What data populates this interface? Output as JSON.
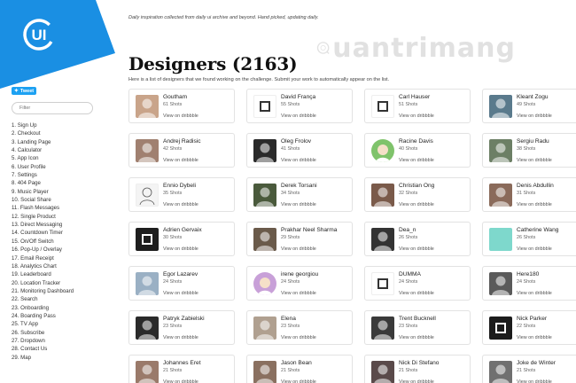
{
  "tagline": "Daily inspiration collected from daily ui archive and beyond. Hand picked, updating daily.",
  "title": "Designers (2163)",
  "subtitle": "Here is a list of designers that we found working on the challenge. Submit your work to automatically appear on the list.",
  "brand": {
    "logo_text": "UI",
    "accent": "#1a8fe3",
    "tweet": "Tweet"
  },
  "watermark": {
    "text": "uantrimang"
  },
  "filter_placeholder": "Filter",
  "nav": [
    "1. Sign Up",
    "2. Checkout",
    "3. Landing Page",
    "4. Calculator",
    "5. App Icon",
    "6. User Profile",
    "7. Settings",
    "8. 404 Page",
    "9. Music Player",
    "10. Social Share",
    "11. Flash Messages",
    "12. Single Product",
    "13. Direct Messaging",
    "14. Countdown Timer",
    "15. On/Off Switch",
    "16. Pop-Up / Overlay",
    "17. Email Receipt",
    "18. Analytics Chart",
    "19. Leaderboard",
    "20. Location Tracker",
    "21. Monitoring Dashboard",
    "22. Search",
    "23. Onboarding",
    "24. Boarding Pass",
    "25. TV App",
    "26. Subscribe",
    "27. Dropdown",
    "28. Contact Us",
    "29. Map"
  ],
  "view_label": "View on dribbble",
  "designers": [
    {
      "name": "Goutham",
      "shots": "61 Shots",
      "avatar": "photo",
      "color": "#c9a48a"
    },
    {
      "name": "David França",
      "shots": "55 Shots",
      "avatar": "logo",
      "color": "#ffffff"
    },
    {
      "name": "Carl Hauser",
      "shots": "51 Shots",
      "avatar": "logo",
      "color": "#ffffff"
    },
    {
      "name": "Kleant Zogu",
      "shots": "49 Shots",
      "avatar": "photo",
      "color": "#5a7a8c"
    },
    {
      "name": "Andrej Radisic",
      "shots": "42 Shots",
      "avatar": "photo",
      "color": "#a08070"
    },
    {
      "name": "Oleg Frolov",
      "shots": "41 Shots",
      "avatar": "photo",
      "color": "#2a2a2a"
    },
    {
      "name": "Racine Davis",
      "shots": "40 Shots",
      "avatar": "illustration",
      "color": "#7fc36b"
    },
    {
      "name": "Sergiu Radu",
      "shots": "38 Shots",
      "avatar": "photo",
      "color": "#6c7f65"
    },
    {
      "name": "Ennio Dybeli",
      "shots": "35 Shots",
      "avatar": "sketch",
      "color": "#f4f4f4"
    },
    {
      "name": "Derek Torsani",
      "shots": "34 Shots",
      "avatar": "photo",
      "color": "#4a5a3c"
    },
    {
      "name": "Christian Ong",
      "shots": "32 Shots",
      "avatar": "photo",
      "color": "#7a5a4a"
    },
    {
      "name": "Denis Abdullin",
      "shots": "31 Shots",
      "avatar": "photo",
      "color": "#8a6a5a"
    },
    {
      "name": "Adrien Gervaix",
      "shots": "30 Shots",
      "avatar": "logo",
      "color": "#1e1e1e"
    },
    {
      "name": "Prakhar Neel Sharma",
      "shots": "29 Shots",
      "avatar": "photo",
      "color": "#6a5a4a"
    },
    {
      "name": "Dea_n",
      "shots": "26 Shots",
      "avatar": "photo",
      "color": "#333333"
    },
    {
      "name": "Catherine Wang",
      "shots": "26 Shots",
      "avatar": "solid",
      "color": "#7ed8cc"
    },
    {
      "name": "Egor Lazarev",
      "shots": "24 Shots",
      "avatar": "photo",
      "color": "#9ab0c4"
    },
    {
      "name": "irene georgiou",
      "shots": "24 Shots",
      "avatar": "illustration",
      "color": "#c8a0d8"
    },
    {
      "name": "DUMMA",
      "shots": "24 Shots",
      "avatar": "logo",
      "color": "#ffffff"
    },
    {
      "name": "Here180",
      "shots": "24 Shots",
      "avatar": "photo",
      "color": "#5a5a5a"
    },
    {
      "name": "Patryk Zabielski",
      "shots": "23 Shots",
      "avatar": "photo",
      "color": "#2a2a2a"
    },
    {
      "name": "Elena",
      "shots": "23 Shots",
      "avatar": "photo",
      "color": "#b0a090"
    },
    {
      "name": "Trent Bucknell",
      "shots": "23 Shots",
      "avatar": "photo",
      "color": "#3a3a3a"
    },
    {
      "name": "Nick Parker",
      "shots": "22 Shots",
      "avatar": "logo",
      "color": "#1c1c1c"
    },
    {
      "name": "Johannes Eret",
      "shots": "21 Shots",
      "avatar": "photo",
      "color": "#9a7a6a"
    },
    {
      "name": "Jason Bean",
      "shots": "21 Shots",
      "avatar": "photo",
      "color": "#8a7060"
    },
    {
      "name": "Nick Di Stefano",
      "shots": "21 Shots",
      "avatar": "photo",
      "color": "#5a4a4a"
    },
    {
      "name": "Joke de Winter",
      "shots": "21 Shots",
      "avatar": "photo",
      "color": "#707070"
    }
  ]
}
